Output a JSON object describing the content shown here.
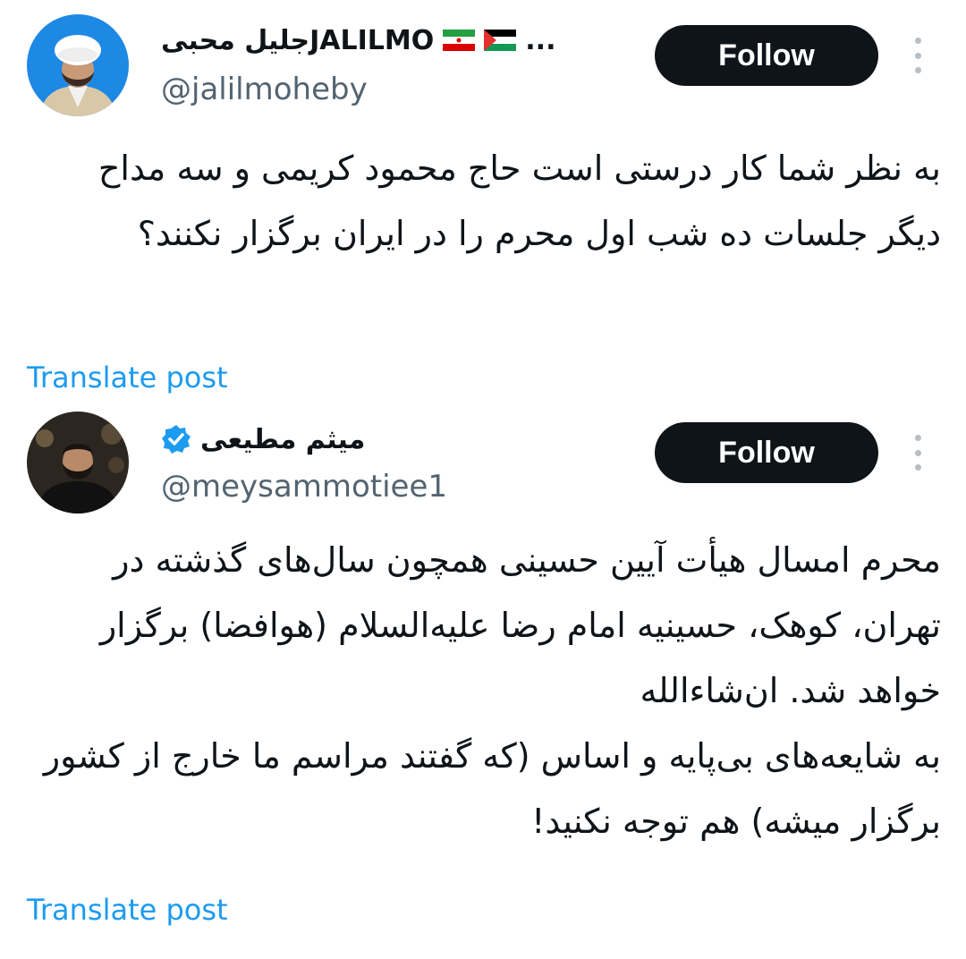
{
  "posts": [
    {
      "display_name": "جلیل محبیJALILMO🇮🇷🇵🇸...",
      "name_text": "جلیل محبیJALILMO",
      "name_suffix": "...",
      "flags": [
        "iran-flag",
        "palestine-flag"
      ],
      "verified": false,
      "handle": "@jalilmoheby",
      "follow_label": "Follow",
      "text": "به نظر شما کار درستی است حاج محمود کریمی و سه مداح دیگر جلسات ده شب اول محرم را در ایران برگزار نکنند؟",
      "translate_label": "Translate post",
      "avatar_icon": "user-avatar-cleric"
    },
    {
      "display_name": "میثم مطیعی",
      "name_text": "میثم مطیعی",
      "verified": true,
      "handle": "@meysammotiee1",
      "follow_label": "Follow",
      "text": "محرم امسال هیأت آیین حسینی همچون سال‌های گذشته در تهران، کوهک، حسینیه امام رضا علیه‌السلام (هوافضا) برگزار خواهد شد. ان‌شاءالله\nبه شایعه‌های بی‌پایه و اساس (که گفتند مراسم ما خارج از کشور برگزار میشه) هم توجه نکنید!",
      "translate_label": "Translate post",
      "avatar_icon": "user-avatar-photo"
    }
  ],
  "colors": {
    "follow_bg": "#0f1419",
    "link": "#1d9bf0",
    "handle": "#536471",
    "verified": "#1d9bf0"
  }
}
